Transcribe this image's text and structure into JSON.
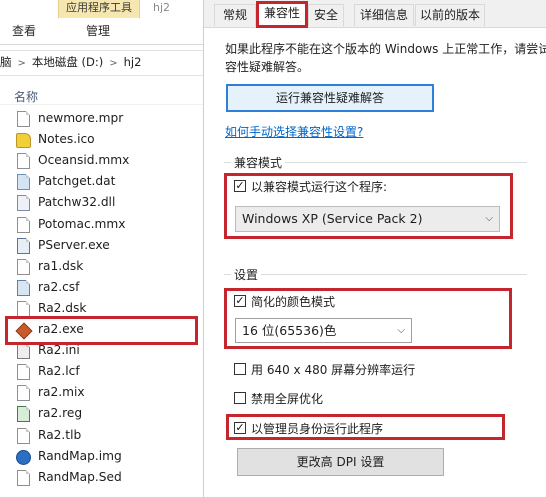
{
  "explorer": {
    "ribbon": {
      "tool_tab": "应用程序工具",
      "folder_name": "hj2",
      "tabs": [
        "查看",
        "管理"
      ]
    },
    "address": {
      "crumbs": [
        "脑",
        "本地磁盘 (D:)",
        "hj2"
      ]
    },
    "column_header": "名称",
    "files": [
      {
        "name": "newmore.mpr",
        "icon": "document-icon"
      },
      {
        "name": "Notes.ico",
        "icon": "icon-file-icon"
      },
      {
        "name": "Oceansid.mmx",
        "icon": "document-icon"
      },
      {
        "name": "Patchget.dat",
        "icon": "dat-file-icon"
      },
      {
        "name": "Patchw32.dll",
        "icon": "dll-file-icon"
      },
      {
        "name": "Potomac.mmx",
        "icon": "document-icon"
      },
      {
        "name": "PServer.exe",
        "icon": "exe-file-icon"
      },
      {
        "name": "ra1.dsk",
        "icon": "document-icon"
      },
      {
        "name": "ra2.csf",
        "icon": "csf-file-icon"
      },
      {
        "name": "Ra2.dsk",
        "icon": "document-icon"
      },
      {
        "name": "ra2.exe",
        "icon": "ra2-app-icon"
      },
      {
        "name": "Ra2.ini",
        "icon": "ini-file-icon"
      },
      {
        "name": "Ra2.lcf",
        "icon": "document-icon"
      },
      {
        "name": "ra2.mix",
        "icon": "document-icon"
      },
      {
        "name": "ra2.reg",
        "icon": "reg-file-icon"
      },
      {
        "name": "Ra2.tlb",
        "icon": "document-icon"
      },
      {
        "name": "RandMap.img",
        "icon": "randmap-app-icon"
      },
      {
        "name": "RandMap.Sed",
        "icon": "document-icon"
      }
    ]
  },
  "dialog": {
    "tabs": [
      "常规",
      "兼容性",
      "安全",
      "详细信息",
      "以前的版本"
    ],
    "active_tab": "兼容性",
    "description_line1": "如果此程序不能在这个版本的 Windows 上正常工作，请尝试",
    "description_line2": "容性疑难解答。",
    "troubleshoot_button": "运行兼容性疑难解答",
    "manual_link": "如何手动选择兼容性设置?",
    "compat_group": {
      "label": "兼容模式",
      "checkbox_label": "以兼容模式运行这个程序:",
      "checked": true,
      "selected_os": "Windows XP (Service Pack 2)"
    },
    "settings_group": {
      "label": "设置",
      "reduced_color": {
        "label": "简化的颜色模式",
        "checked": true
      },
      "color_select": "16 位(65536)色",
      "run_640": {
        "label": "用 640 x 480 屏幕分辨率运行",
        "checked": false
      },
      "disable_fullscreen": {
        "label": "禁用全屏优化",
        "checked": false
      },
      "run_admin": {
        "label": "以管理员身份运行此程序",
        "checked": true
      },
      "dpi_button": "更改高 DPI 设置"
    }
  },
  "colors": {
    "highlight": "#c4262e",
    "link": "#0066cc",
    "focus": "#2d7fd8"
  }
}
